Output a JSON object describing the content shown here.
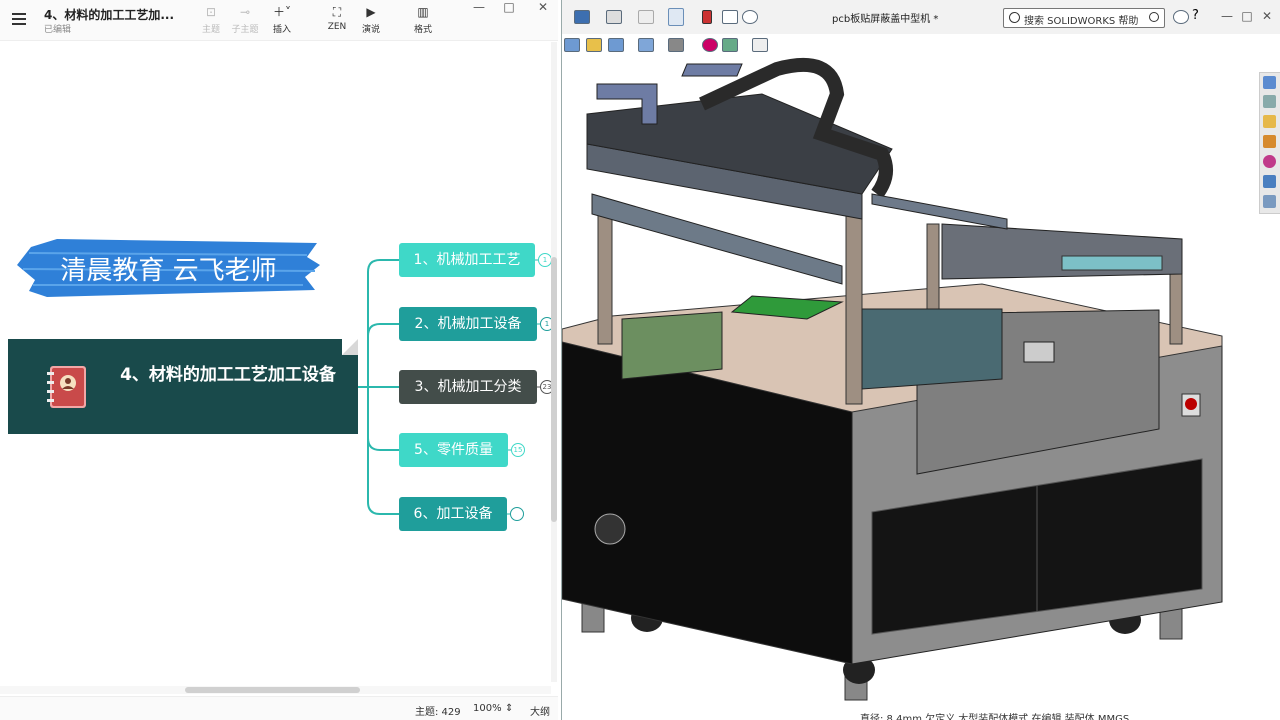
{
  "left_app": {
    "doc_title": "4、材料的加工工艺加...",
    "doc_status": "已编辑",
    "toolbar": {
      "topic": "主题",
      "subtopic": "子主题",
      "insert": "插入",
      "zen": "ZEN",
      "present": "演说",
      "format": "格式"
    },
    "window_controls": {
      "minimize": "—",
      "maximize": "□",
      "close": "✕"
    },
    "mindmap": {
      "brand": "清晨教育 云飞老师",
      "central": "4、材料的加工工艺加工设备",
      "nodes": [
        {
          "label": "1、机械加工工艺",
          "badge": "1",
          "color": "#3fd8c8"
        },
        {
          "label": "2、机械加工设备",
          "badge": "1",
          "color": "#1f9e9b"
        },
        {
          "label": "3、机械加工分类",
          "badge": "23",
          "color": "#434d4a"
        },
        {
          "label": "5、零件质量",
          "badge": "15",
          "color": "#3fd8c8"
        },
        {
          "label": "6、加工设备",
          "badge": "",
          "color": "#1f9e9b"
        }
      ]
    },
    "status": {
      "topics": "主题: 429",
      "zoom": "100%",
      "outline": "大纲"
    }
  },
  "right_app": {
    "title": "pcb板贴屏蔽盖中型机 *",
    "search_placeholder": "搜索 SOLIDWORKS 帮助",
    "help": "?",
    "window_controls": {
      "minimize": "—",
      "maximize": "□",
      "close": "✕"
    },
    "status_text": "直径: 8.4mm   欠定义   大型装配体模式   在编辑 装配体          MMGS"
  }
}
